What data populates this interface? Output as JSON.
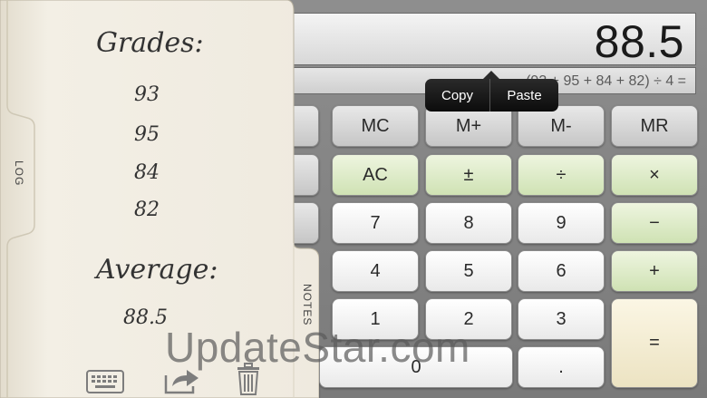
{
  "display": {
    "value": "88.5",
    "expression": "(93 + 95 + 84 + 82) ÷ 4 ="
  },
  "popup": {
    "copy_label": "Copy",
    "paste_label": "Paste"
  },
  "keypad": {
    "rows": [
      [
        "MC",
        "M+",
        "M-",
        "MR"
      ],
      [
        "AC",
        "±",
        "÷",
        "×"
      ],
      [
        "7",
        "8",
        "9",
        "−"
      ],
      [
        "4",
        "5",
        "6",
        "+"
      ],
      [
        "1",
        "2",
        "3",
        "="
      ],
      [
        "0",
        "."
      ]
    ]
  },
  "notes": {
    "heading": "Grades:",
    "grades": [
      "93",
      "95",
      "84",
      "82"
    ],
    "average_label": "Average:",
    "average_value": "88.5"
  },
  "tabs": {
    "log": "LOG",
    "notes": "NOTES"
  },
  "icons": {
    "keyboard": "keyboard-icon",
    "share": "share-icon",
    "trash": "trash-icon"
  },
  "watermark": "UpdateStar.com",
  "colors": {
    "green_key": "#cfe2b4",
    "cream_key": "#ece3c2",
    "paper": "#f0ebe0"
  }
}
